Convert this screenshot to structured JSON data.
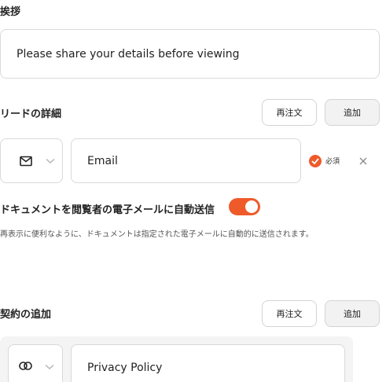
{
  "greeting": {
    "title": "挨拶",
    "message": "Please share your details before viewing"
  },
  "lead_details": {
    "title": "リードの詳細",
    "reorder_label": "再注文",
    "add_label": "追加",
    "field": {
      "icon": "mail-icon",
      "value": "Email",
      "required_label": "必須",
      "required": true
    },
    "auto_send": {
      "label": "ドキュメントを閲覧者の電子メールに自動送信",
      "enabled": true,
      "description": "再表示に便利なように、ドキュメントは指定された電子メールに自動的に送信されます。"
    }
  },
  "contracts": {
    "title": "契約の追加",
    "reorder_label": "再注文",
    "add_label": "追加",
    "item": {
      "icon": "link-icon",
      "value": "Privacy Policy"
    }
  },
  "colors": {
    "accent": "#ef5a2a",
    "border": "#d9d9d9",
    "panel": "#f4f4f4"
  }
}
